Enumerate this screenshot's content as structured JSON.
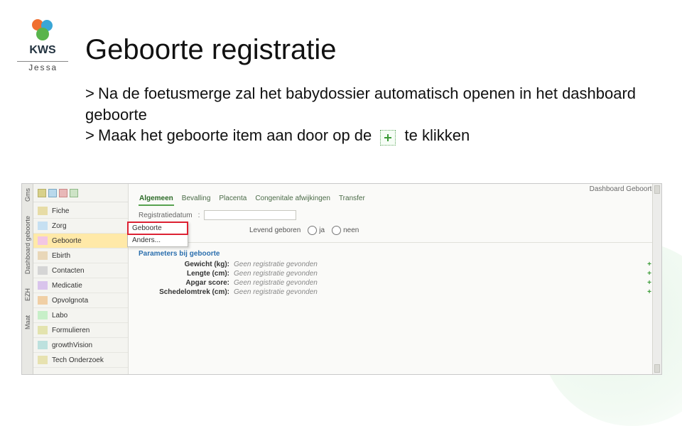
{
  "logo": {
    "kws": "KWS",
    "jessa": "Jessa"
  },
  "title": "Geboorte registratie",
  "bullets": {
    "b1": "Na de foetusmerge zal het babydossier automatisch openen in het dashboard geboorte",
    "b2a": "Maak het geboorte item aan door op de",
    "b2b": "te klikken"
  },
  "app": {
    "dashboard_title": "Dashboard Geboorte",
    "vrail": [
      "Gms",
      "Dashboard geboorte",
      "EZH",
      "Maat"
    ],
    "nav": [
      {
        "label": "Fiche"
      },
      {
        "label": "Zorg"
      },
      {
        "label": "Geboorte"
      },
      {
        "label": "Ebirth"
      },
      {
        "label": "Contacten"
      },
      {
        "label": "Medicatie"
      },
      {
        "label": "Opvolgnota"
      },
      {
        "label": "Labo"
      },
      {
        "label": "Formulieren"
      },
      {
        "label": "growthVision"
      },
      {
        "label": "Tech Onderzoek"
      }
    ],
    "flyout": {
      "item1": "Geboorte",
      "item2": "Anders..."
    },
    "tabs": [
      "Algemeen",
      "Bevalling",
      "Placenta",
      "Congenitale afwijkingen",
      "Transfer"
    ],
    "reg_label": "Registratiedatum",
    "born_label": "Levend geboren",
    "born_opts": [
      "ja",
      "neen"
    ],
    "params_title": "Parameters bij geboorte",
    "params": [
      {
        "label": "Gewicht (kg):",
        "value": "Geen registratie gevonden"
      },
      {
        "label": "Lengte (cm):",
        "value": "Geen registratie gevonden"
      },
      {
        "label": "Apgar score:",
        "value": "Geen registratie gevonden"
      },
      {
        "label": "Schedelomtrek (cm):",
        "value": "Geen registratie gevonden"
      }
    ]
  }
}
